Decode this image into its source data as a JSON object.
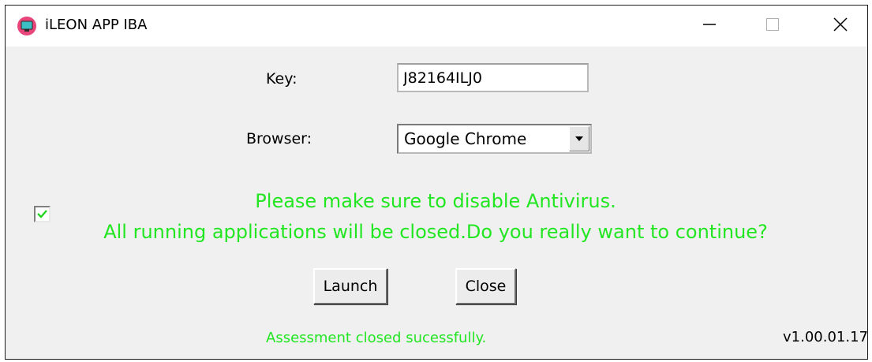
{
  "window": {
    "title": "iLEON APP IBA"
  },
  "form": {
    "key_label": "Key:",
    "key_value": "J82164ILJ0",
    "browser_label": "Browser:",
    "browser_selected": "Google Chrome",
    "checkbox_checked": true
  },
  "messages": {
    "warning_line1": "Please make sure to disable Antivirus.",
    "warning_line2": "All running applications will be closed.Do you really want to continue?",
    "status": "Assessment closed sucessfully.",
    "version": "v1.00.01.17"
  },
  "buttons": {
    "launch_label": "Launch",
    "close_label": "Close"
  },
  "colors": {
    "message_green": "#22e622",
    "app_icon_pink": "#e8457a",
    "app_icon_teal": "#3bbfc4"
  },
  "icons": {
    "app": "app-icon",
    "minimize": "minimize-icon",
    "maximize": "maximize-icon",
    "close": "close-icon",
    "dropdown": "dropdown-arrow-icon",
    "checkmark": "checkmark-icon"
  }
}
